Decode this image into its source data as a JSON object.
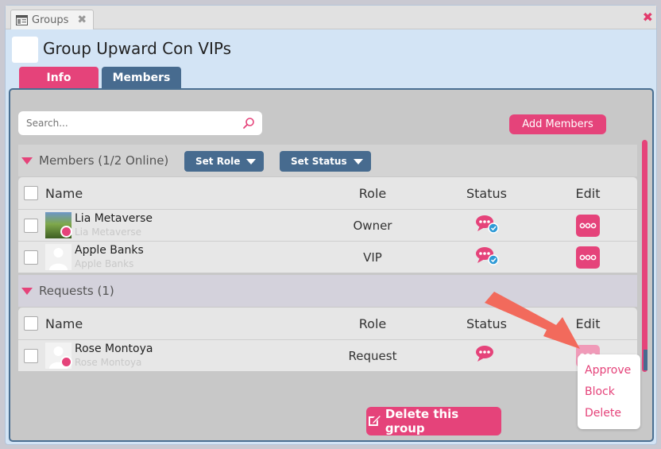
{
  "window": {
    "tab_title": "Groups",
    "group_title": "Group Upward Con VIPs"
  },
  "tabs": [
    {
      "label": "Info",
      "active": true
    },
    {
      "label": "Members",
      "active": false
    }
  ],
  "search": {
    "placeholder": "Search..."
  },
  "add_members_label": "Add Members",
  "members_section": {
    "title": "Members (1/2 Online)",
    "set_role_label": "Set Role",
    "set_status_label": "Set Status"
  },
  "table_headers": {
    "name": "Name",
    "role": "Role",
    "status": "Status",
    "edit": "Edit"
  },
  "members": [
    {
      "name": "Lia Metaverse",
      "subname": "Lia Metaverse",
      "role": "Owner",
      "online": true
    },
    {
      "name": "Apple Banks",
      "subname": "Apple Banks",
      "role": "VIP",
      "online": false
    }
  ],
  "requests_section": {
    "title": "Requests (1)"
  },
  "requests": [
    {
      "name": "Rose Montoya",
      "subname": "Rose Montoya",
      "role": "Request",
      "online": true
    }
  ],
  "delete_group_label": "Delete this group",
  "edit_menu": [
    "Approve",
    "Block",
    "Delete"
  ],
  "colors": {
    "accent": "#e5437a",
    "secondary": "#476b8f",
    "verified": "#2f9ad6"
  },
  "icons": [
    "window-icon",
    "close-icon",
    "search-icon",
    "chevron-down-icon",
    "chat-bubble-icon",
    "check-badge-icon",
    "more-dots-icon",
    "edit-pencil-icon",
    "arrow-pointer"
  ]
}
